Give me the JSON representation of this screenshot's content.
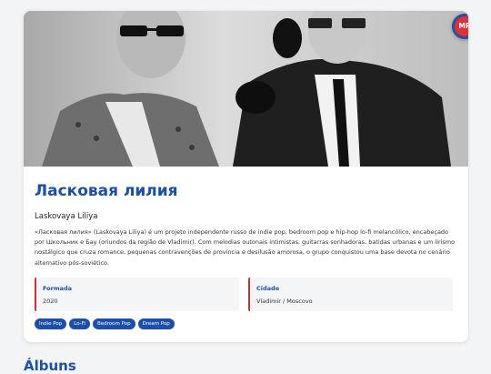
{
  "artist": {
    "name": "Ласковая лилия",
    "latin_name": "Laskovaya Liliya",
    "description": "«Ласковая лилия» (Laskovaya Liliya) é um projeto independente russo de indie pop, bedroom pop e hip-hop lo-fi melancólico, encabeçado por Школьник e Бау (oriundos da região de Vladimir). Com melodias outonais intimistas, guitarras sonhadoras, batidas urbanas e um lirismo nostálgico que cruza romance, pequenas contravenções de província e desilusão amorosa, o grupo conquistou uma base devota no cenário alternativo pós-soviético.",
    "photo_icon": "band-photo-icon"
  },
  "info": {
    "formed_label": "Formada",
    "formed_value": "2020",
    "city_label": "Cidade",
    "city_value": "Vladimir / Moscovo"
  },
  "tags": [
    "Indie Pop",
    "Lo-Fi",
    "Bedroom Pop",
    "Dream Pop"
  ],
  "badge": {
    "text": "MR",
    "outer_color": "#2b4d9e",
    "inner_color": "#d9323a"
  },
  "sections": {
    "albums_title": "Álbuns"
  },
  "colors": {
    "accent": "#1d4ea8",
    "info_border": "#c4333b",
    "background": "#f3f4f6"
  }
}
